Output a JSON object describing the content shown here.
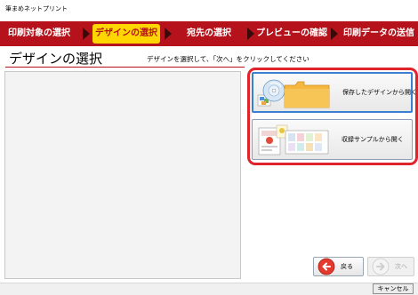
{
  "window": {
    "title": "筆まめネットプリント"
  },
  "steps": [
    {
      "label": "印刷対象の選択",
      "active": false
    },
    {
      "label": "デザインの選択",
      "active": true
    },
    {
      "label": "宛先の選択",
      "active": false
    },
    {
      "label": "プレビューの確認",
      "active": false
    },
    {
      "label": "印刷データの送信",
      "active": false
    }
  ],
  "header": {
    "title": "デザインの選択",
    "instruction": "デザインを選択して、「次へ」をクリックしてください"
  },
  "options": {
    "saved_design_label": "保存したデザインから開く",
    "sample_label": "収録サンプルから開く"
  },
  "nav": {
    "back_label": "戻る",
    "next_label": "次へ"
  },
  "footer": {
    "cancel_label": "キャンセル"
  },
  "colors": {
    "step_bar": "#b5121b",
    "active_step": "#ffd600",
    "highlight": "#e0242c",
    "selected_border": "#3b7fd0"
  }
}
